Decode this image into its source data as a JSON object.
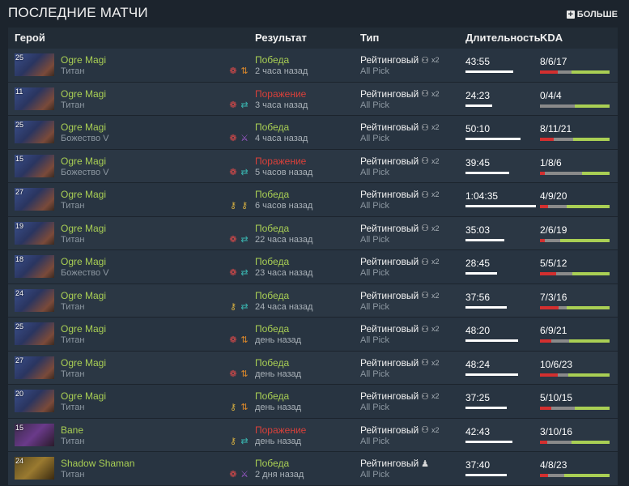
{
  "header": {
    "title": "ПОСЛЕДНИЕ МАТЧИ",
    "more_label": "БОЛЬШЕ"
  },
  "columns": {
    "hero": "Герой",
    "result": "Результат",
    "type": "Тип",
    "duration": "Длительность",
    "kda": "KDA"
  },
  "colors": {
    "win": "#a9cf54",
    "loss": "#d9403a",
    "kills": "#d32f2f",
    "deaths": "#8a8a8a",
    "assists": "#a9cf54"
  },
  "matches": [
    {
      "hero": "Ogre Magi",
      "level": "25",
      "rank": "Титан",
      "items": [
        "red",
        "orange-arrows"
      ],
      "result": "Победа",
      "win": true,
      "ago": "2 часа назад",
      "type": "Рейтинговый",
      "party": "group",
      "party_count": "x2",
      "mode": "All Pick",
      "duration": "43:55",
      "dur_frac": 0.67,
      "kda": "8/6/17",
      "k": 8,
      "d": 6,
      "a": 17
    },
    {
      "hero": "Ogre Magi",
      "level": "11",
      "rank": "Титан",
      "items": [
        "red",
        "teal-swap"
      ],
      "result": "Поражение",
      "win": false,
      "ago": "3 часа назад",
      "type": "Рейтинговый",
      "party": "group",
      "party_count": "x2",
      "mode": "All Pick",
      "duration": "24:23",
      "dur_frac": 0.37,
      "kda": "0/4/4",
      "k": 0,
      "d": 4,
      "a": 4
    },
    {
      "hero": "Ogre Magi",
      "level": "25",
      "rank": "Божество V",
      "items": [
        "red",
        "purple-sword"
      ],
      "result": "Победа",
      "win": true,
      "ago": "4 часа назад",
      "type": "Рейтинговый",
      "party": "group",
      "party_count": "x2",
      "mode": "All Pick",
      "duration": "50:10",
      "dur_frac": 0.77,
      "kda": "8/11/21",
      "k": 8,
      "d": 11,
      "a": 21
    },
    {
      "hero": "Ogre Magi",
      "level": "15",
      "rank": "Божество V",
      "items": [
        "red",
        "teal-swap"
      ],
      "result": "Поражение",
      "win": false,
      "ago": "5 часов назад",
      "type": "Рейтинговый",
      "party": "group",
      "party_count": "x2",
      "mode": "All Pick",
      "duration": "39:45",
      "dur_frac": 0.61,
      "kda": "1/8/6",
      "k": 1,
      "d": 8,
      "a": 6
    },
    {
      "hero": "Ogre Magi",
      "level": "27",
      "rank": "Титан",
      "items": [
        "gold-key",
        "gold-key"
      ],
      "result": "Победа",
      "win": true,
      "ago": "6 часов назад",
      "type": "Рейтинговый",
      "party": "group",
      "party_count": "x2",
      "mode": "All Pick",
      "duration": "1:04:35",
      "dur_frac": 0.99,
      "kda": "4/9/20",
      "k": 4,
      "d": 9,
      "a": 20
    },
    {
      "hero": "Ogre Magi",
      "level": "19",
      "rank": "Титан",
      "items": [
        "red",
        "teal-swap"
      ],
      "result": "Победа",
      "win": true,
      "ago": "22 часа назад",
      "type": "Рейтинговый",
      "party": "group",
      "party_count": "x2",
      "mode": "All Pick",
      "duration": "35:03",
      "dur_frac": 0.54,
      "kda": "2/6/19",
      "k": 2,
      "d": 6,
      "a": 19
    },
    {
      "hero": "Ogre Magi",
      "level": "18",
      "rank": "Божество V",
      "items": [
        "red",
        "teal-swap"
      ],
      "result": "Победа",
      "win": true,
      "ago": "23 часа назад",
      "type": "Рейтинговый",
      "party": "group",
      "party_count": "x2",
      "mode": "All Pick",
      "duration": "28:45",
      "dur_frac": 0.44,
      "kda": "5/5/12",
      "k": 5,
      "d": 5,
      "a": 12
    },
    {
      "hero": "Ogre Magi",
      "level": "24",
      "rank": "Титан",
      "items": [
        "gold-key",
        "teal-swap"
      ],
      "result": "Победа",
      "win": true,
      "ago": "24 часа назад",
      "type": "Рейтинговый",
      "party": "group",
      "party_count": "x2",
      "mode": "All Pick",
      "duration": "37:56",
      "dur_frac": 0.58,
      "kda": "7/3/16",
      "k": 7,
      "d": 3,
      "a": 16
    },
    {
      "hero": "Ogre Magi",
      "level": "25",
      "rank": "Титан",
      "items": [
        "red",
        "orange-arrows"
      ],
      "result": "Победа",
      "win": true,
      "ago": "день назад",
      "type": "Рейтинговый",
      "party": "group",
      "party_count": "x2",
      "mode": "All Pick",
      "duration": "48:20",
      "dur_frac": 0.74,
      "kda": "6/9/21",
      "k": 6,
      "d": 9,
      "a": 21
    },
    {
      "hero": "Ogre Magi",
      "level": "27",
      "rank": "Титан",
      "items": [
        "red",
        "orange-arrows"
      ],
      "result": "Победа",
      "win": true,
      "ago": "день назад",
      "type": "Рейтинговый",
      "party": "group",
      "party_count": "x2",
      "mode": "All Pick",
      "duration": "48:24",
      "dur_frac": 0.74,
      "kda": "10/6/23",
      "k": 10,
      "d": 6,
      "a": 23
    },
    {
      "hero": "Ogre Magi",
      "level": "20",
      "rank": "Титан",
      "items": [
        "gold-key",
        "orange-arrows"
      ],
      "result": "Победа",
      "win": true,
      "ago": "день назад",
      "type": "Рейтинговый",
      "party": "group",
      "party_count": "x2",
      "mode": "All Pick",
      "duration": "37:25",
      "dur_frac": 0.58,
      "kda": "5/10/15",
      "k": 5,
      "d": 10,
      "a": 15
    },
    {
      "hero": "Bane",
      "level": "15",
      "rank": "Титан",
      "items": [
        "gold-key",
        "teal-swap"
      ],
      "result": "Поражение",
      "win": false,
      "ago": "день назад",
      "type": "Рейтинговый",
      "party": "group",
      "party_count": "x2",
      "mode": "All Pick",
      "duration": "42:43",
      "dur_frac": 0.66,
      "kda": "3/10/16",
      "k": 3,
      "d": 10,
      "a": 16
    },
    {
      "hero": "Shadow Shaman",
      "level": "24",
      "rank": "Титан",
      "items": [
        "red",
        "purple-sword"
      ],
      "result": "Победа",
      "win": true,
      "ago": "2 дня назад",
      "type": "Рейтинговый",
      "party": "solo",
      "party_count": "",
      "mode": "All Pick",
      "duration": "37:40",
      "dur_frac": 0.58,
      "kda": "4/8/23",
      "k": 4,
      "d": 8,
      "a": 23
    }
  ]
}
